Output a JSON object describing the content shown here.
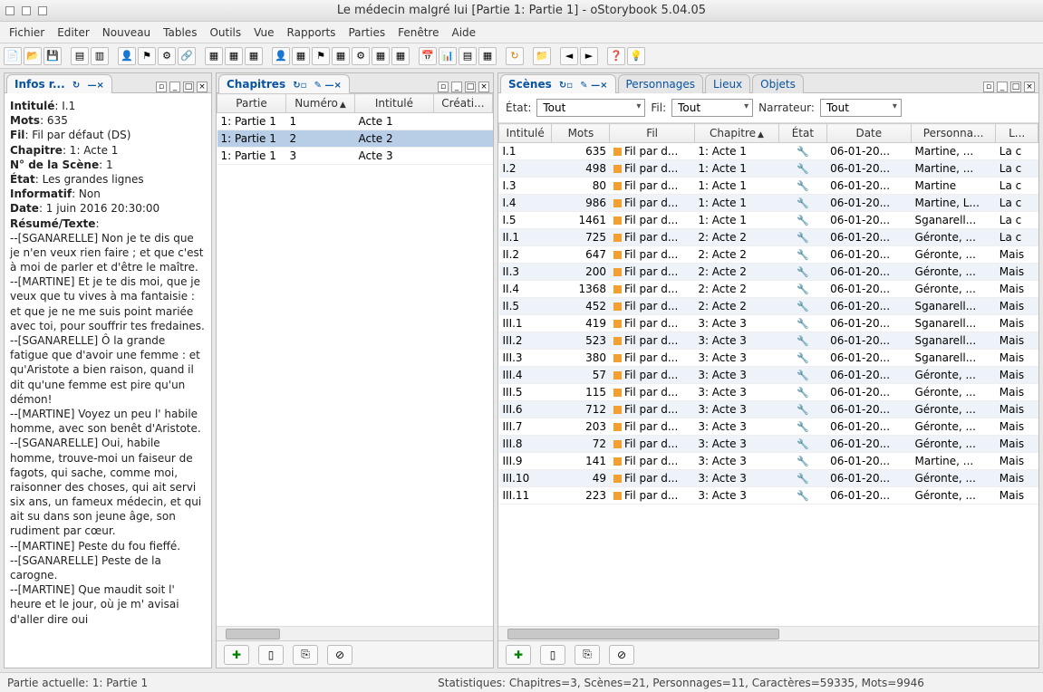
{
  "window": {
    "title": "Le médecin malgré lui [Partie 1: Partie 1] - oStorybook 5.04.05"
  },
  "menu": {
    "items": [
      "Fichier",
      "Editer",
      "Nouveau",
      "Tables",
      "Outils",
      "Vue",
      "Rapports",
      "Parties",
      "Fenêtre",
      "Aide"
    ]
  },
  "panels": {
    "info": {
      "title": "Infos r..."
    },
    "chapters": {
      "title": "Chapitres"
    },
    "scenes": {
      "title": "Scènes"
    },
    "tabs_inactive": [
      "Personnages",
      "Lieux",
      "Objets"
    ]
  },
  "info": {
    "intitule_lbl": "Intitulé",
    "intitule": ": I.1",
    "mots_lbl": "Mots",
    "mots": ": 635",
    "fil_lbl": "Fil",
    "fil": ": Fil par défaut (DS)",
    "chapitre_lbl": "Chapitre",
    "chapitre": ": 1: Acte 1",
    "nscene_lbl": "N° de la Scène",
    "nscene": ": 1",
    "etat_lbl": "État",
    "etat": ": Les grandes lignes",
    "informatif_lbl": "Informatif",
    "informatif": ": Non",
    "date_lbl": "Date",
    "date": ": 1 juin 2016 20:30:00",
    "resume_lbl": "Résumé/Texte",
    "resume_colon": ":",
    "body": "--[SGANARELLE] Non je te dis que je n'en veux rien faire ; et que c'est à moi de parler et d'être le maître.\n--[MARTINE] Et je te dis moi, que je veux que tu vives à ma fantaisie : et que je ne me suis point mariée avec toi, pour souffrir tes fredaines.\n--[SGANARELLE] Ô la grande fatigue que d'avoir une femme : et qu'Aristote a bien raison, quand il dit qu'une femme est pire qu'un démon!\n--[MARTINE] Voyez un peu l' habile homme, avec son benêt d'Aristote.\n--[SGANARELLE] Oui, habile homme, trouve-moi un faiseur de fagots, qui sache, comme moi, raisonner des choses, qui ait servi six ans, un fameux médecin, et qui ait su dans son jeune âge, son rudiment par cœur.\n--[MARTINE] Peste du fou fieffé.\n--[SGANARELLE] Peste de la carogne.\n--[MARTINE] Que maudit soit l' heure et le jour, où je m' avisai d'aller dire oui"
  },
  "chapters": {
    "headers": [
      "Partie",
      "Numéro",
      "Intitulé",
      "Créati..."
    ],
    "rows": [
      {
        "partie": "1: Partie 1",
        "num": "1",
        "intitule": "Acte 1"
      },
      {
        "partie": "1: Partie 1",
        "num": "2",
        "intitule": "Acte 2"
      },
      {
        "partie": "1: Partie 1",
        "num": "3",
        "intitule": "Acte 3"
      }
    ],
    "selected_index": 1
  },
  "filters": {
    "etat_lbl": "État:",
    "etat_val": "Tout",
    "fil_lbl": "Fil:",
    "fil_val": "Tout",
    "narr_lbl": "Narrateur:",
    "narr_val": "Tout"
  },
  "scenes": {
    "headers": [
      "Intitulé",
      "Mots",
      "Fil",
      "Chapitre",
      "État",
      "Date",
      "Personna...",
      "L..."
    ],
    "rows": [
      {
        "i": "I.1",
        "m": "635",
        "f": "Fil par d...",
        "c": "1: Acte 1",
        "d": "06-01-20...",
        "p": "Martine, ...",
        "l": "La c"
      },
      {
        "i": "I.2",
        "m": "498",
        "f": "Fil par d...",
        "c": "1: Acte 1",
        "d": "06-01-20...",
        "p": "Martine, ...",
        "l": "La c"
      },
      {
        "i": "I.3",
        "m": "80",
        "f": "Fil par d...",
        "c": "1: Acte 1",
        "d": "06-01-20...",
        "p": "Martine",
        "l": "La c"
      },
      {
        "i": "I.4",
        "m": "986",
        "f": "Fil par d...",
        "c": "1: Acte 1",
        "d": "06-01-20...",
        "p": "Martine, L...",
        "l": "La c"
      },
      {
        "i": "I.5",
        "m": "1461",
        "f": "Fil par d...",
        "c": "1: Acte 1",
        "d": "06-01-20...",
        "p": "Sganarell...",
        "l": "La c"
      },
      {
        "i": "II.1",
        "m": "725",
        "f": "Fil par d...",
        "c": "2: Acte 2",
        "d": "06-01-20...",
        "p": "Géronte, ...",
        "l": "La c"
      },
      {
        "i": "II.2",
        "m": "647",
        "f": "Fil par d...",
        "c": "2: Acte 2",
        "d": "06-01-20...",
        "p": "Géronte, ...",
        "l": "Mais"
      },
      {
        "i": "II.3",
        "m": "200",
        "f": "Fil par d...",
        "c": "2: Acte 2",
        "d": "06-01-20...",
        "p": "Géronte, ...",
        "l": "Mais"
      },
      {
        "i": "II.4",
        "m": "1368",
        "f": "Fil par d...",
        "c": "2: Acte 2",
        "d": "06-01-20...",
        "p": "Géronte, ...",
        "l": "Mais"
      },
      {
        "i": "II.5",
        "m": "452",
        "f": "Fil par d...",
        "c": "2: Acte 2",
        "d": "06-01-20...",
        "p": "Sganarell...",
        "l": "Mais"
      },
      {
        "i": "III.1",
        "m": "419",
        "f": "Fil par d...",
        "c": "3: Acte 3",
        "d": "06-01-20...",
        "p": "Sganarell...",
        "l": "Mais"
      },
      {
        "i": "III.2",
        "m": "523",
        "f": "Fil par d...",
        "c": "3: Acte 3",
        "d": "06-01-20...",
        "p": "Sganarell...",
        "l": "Mais"
      },
      {
        "i": "III.3",
        "m": "380",
        "f": "Fil par d...",
        "c": "3: Acte 3",
        "d": "06-01-20...",
        "p": "Sganarell...",
        "l": "Mais"
      },
      {
        "i": "III.4",
        "m": "57",
        "f": "Fil par d...",
        "c": "3: Acte 3",
        "d": "06-01-20...",
        "p": "Géronte, ...",
        "l": "Mais"
      },
      {
        "i": "III.5",
        "m": "115",
        "f": "Fil par d...",
        "c": "3: Acte 3",
        "d": "06-01-20...",
        "p": "Géronte, ...",
        "l": "Mais"
      },
      {
        "i": "III.6",
        "m": "712",
        "f": "Fil par d...",
        "c": "3: Acte 3",
        "d": "06-01-20...",
        "p": "Géronte, ...",
        "l": "Mais"
      },
      {
        "i": "III.7",
        "m": "203",
        "f": "Fil par d...",
        "c": "3: Acte 3",
        "d": "06-01-20...",
        "p": "Géronte, ...",
        "l": "Mais"
      },
      {
        "i": "III.8",
        "m": "72",
        "f": "Fil par d...",
        "c": "3: Acte 3",
        "d": "06-01-20...",
        "p": "Géronte, ...",
        "l": "Mais"
      },
      {
        "i": "III.9",
        "m": "141",
        "f": "Fil par d...",
        "c": "3: Acte 3",
        "d": "06-01-20...",
        "p": "Martine, ...",
        "l": "Mais"
      },
      {
        "i": "III.10",
        "m": "49",
        "f": "Fil par d...",
        "c": "3: Acte 3",
        "d": "06-01-20...",
        "p": "Géronte, ...",
        "l": "Mais"
      },
      {
        "i": "III.11",
        "m": "223",
        "f": "Fil par d...",
        "c": "3: Acte 3",
        "d": "06-01-20...",
        "p": "Géronte, ...",
        "l": "Mais"
      }
    ]
  },
  "status": {
    "partie": "Partie actuelle: 1: Partie 1",
    "stats": "Statistiques: Chapitres=3,  Scènes=21,  Personnages=11,  Caractères=59335,  Mots=9946"
  }
}
